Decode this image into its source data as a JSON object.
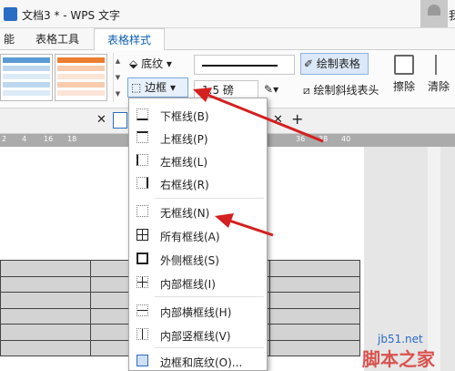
{
  "title": "文档3 * - WPS 文字",
  "user_initial": "我",
  "tabs": {
    "func": "能",
    "table_tools": "表格工具",
    "table_style": "表格样式"
  },
  "ribbon": {
    "shading": "底纹",
    "border": "边框",
    "line_width": "1.5 磅",
    "draw_table": "绘制表格",
    "draw_diagonal": "绘制斜线表头",
    "erase": "擦除",
    "clear_table": "清除"
  },
  "ruler_ticks": [
    "2",
    "4",
    "16",
    "18",
    "36",
    "38",
    "40"
  ],
  "border_menu": {
    "items": [
      "下框线(B)",
      "上框线(P)",
      "左框线(L)",
      "右框线(R)",
      "无框线(N)",
      "所有框线(A)",
      "外侧框线(S)",
      "内部框线(I)",
      "内部横框线(H)",
      "内部竖框线(V)",
      "边框和底纹(O)..."
    ]
  },
  "watermark": {
    "domain": "jb51.net",
    "name": "脚本之家"
  },
  "colors": {
    "accent": "#2b6cc4",
    "arrow": "#d42020",
    "table_fill": "#d3d3d3"
  },
  "icons": [
    "app-icon",
    "shading-icon",
    "border-icon",
    "pen-color-icon",
    "draw-table-icon",
    "diagonal-icon",
    "eraser-icon",
    "close-icon",
    "plus-icon"
  ]
}
